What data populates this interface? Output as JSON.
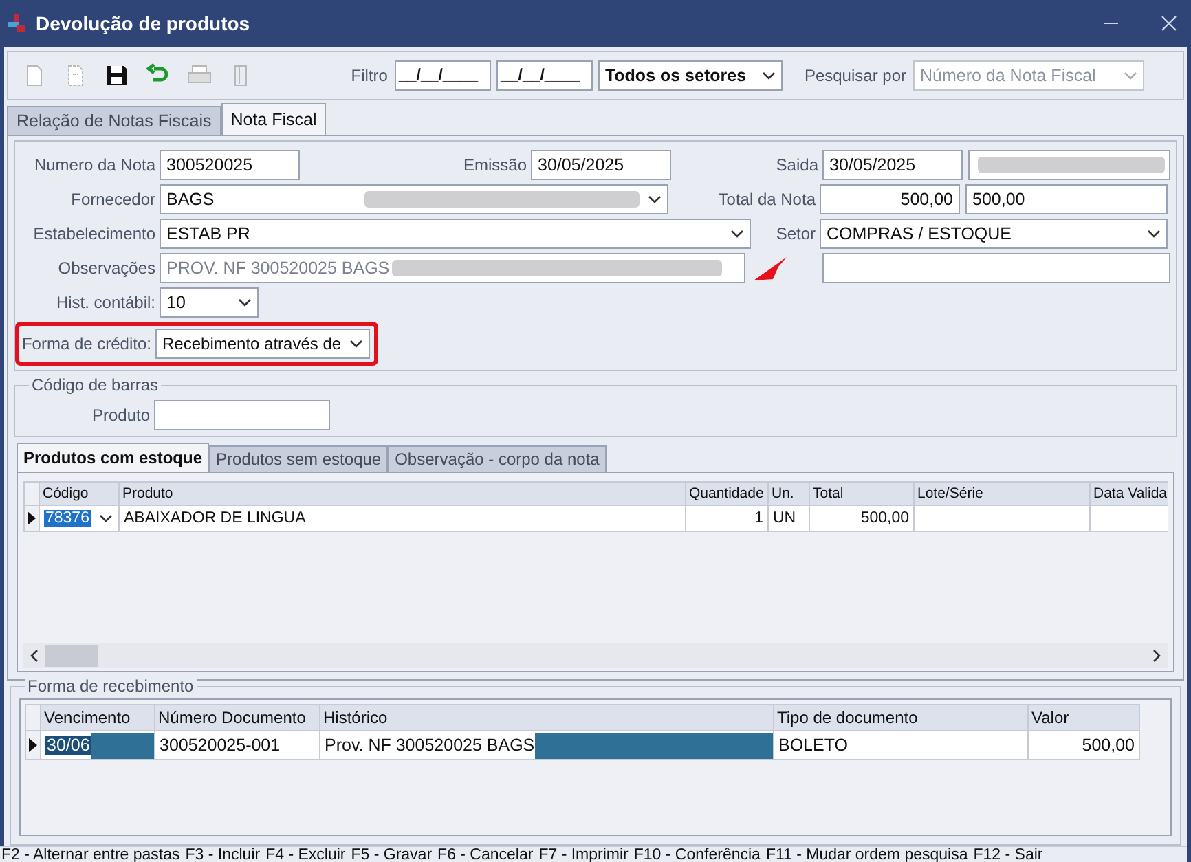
{
  "window": {
    "title": "Devolução de produtos"
  },
  "toolbar": {
    "filter_label": "Filtro",
    "date_from": "__/__/____",
    "date_to": "__/__/____",
    "sector": "Todos os setores",
    "search_label": "Pesquisar por",
    "search_by": {
      "value": "Número da Nota Fiscal",
      "disabled": true
    }
  },
  "tabs": [
    {
      "label": "Relação de Notas Fiscais",
      "selected": false
    },
    {
      "label": "Nota Fiscal",
      "selected": true
    }
  ],
  "nota": {
    "numero": {
      "label": "Numero da Nota",
      "value": "300520025"
    },
    "emissao": {
      "label": "Emissão",
      "value": "30/05/2025"
    },
    "saida": {
      "label": "Saida",
      "value": "30/05/2025"
    },
    "saida_extra": {
      "redacted": true
    },
    "fornecedor": {
      "label": "Fornecedor",
      "value": "BAGS",
      "redacted": true
    },
    "total": {
      "label": "Total da Nota",
      "value": "500,00"
    },
    "total_2": {
      "value": "500,00"
    },
    "estabelecimento": {
      "label": "Estabelecimento",
      "value": "ESTAB PR"
    },
    "setor": {
      "label": "Setor",
      "value": "COMPRAS / ESTOQUE"
    },
    "observacoes": {
      "label": "Observações",
      "value": "PROV. NF 300520025 BAGS",
      "redacted": true
    },
    "hist_contabil": {
      "label": "Hist. contábil:",
      "value": "10"
    },
    "forma_credito": {
      "label": "Forma de crédito:",
      "value": "Recebimento através de",
      "highlighted": true
    }
  },
  "barcode": {
    "title": "Código de barras",
    "label": "Produto"
  },
  "product_tabs": [
    {
      "label": "Produtos com estoque",
      "selected": true
    },
    {
      "label": "Produtos sem estoque",
      "selected": false
    },
    {
      "label": "Observação - corpo da nota",
      "selected": false
    }
  ],
  "products": {
    "columns": [
      "Código",
      "Produto",
      "Quantidade",
      "Un.",
      "Total",
      "Lote/Série",
      "Data Valida"
    ],
    "rows": [
      {
        "current": true,
        "cells": [
          {
            "text": "78376",
            "selected": true
          },
          {
            "text": "ABAIXADOR DE LINGUA",
            "selected": false
          },
          {
            "text": "1",
            "selected": false
          },
          {
            "text": "UN",
            "selected": false
          },
          {
            "text": "500,00",
            "selected": false
          }
        ]
      }
    ]
  },
  "receipt": {
    "title": "Forma de recebimento",
    "columns": [
      "Vencimento",
      "Número Documento",
      "Histórico",
      "Tipo de documento",
      "Valor"
    ],
    "rows": [
      {
        "current": true,
        "cells": [
          {
            "text": "30/06",
            "selected": true,
            "redacted": true
          },
          {
            "text": "300520025-001",
            "selected": false
          },
          {
            "text": "Prov. NF 300520025 BAGS",
            "selected": false,
            "redacted": true
          },
          {
            "text": "BOLETO",
            "selected": false
          },
          {
            "text": "500,00",
            "selected": false
          }
        ]
      }
    ]
  },
  "status_bar": [
    "F2 - Alternar entre pastas",
    "F3 - Incluir",
    "F4 - Excluir",
    "F5 - Gravar",
    "F6 - Cancelar",
    "F7 - Imprimir",
    "F10 - Conferência",
    "F11 - Mudar ordem pesquisa",
    "F12 - Sair"
  ]
}
